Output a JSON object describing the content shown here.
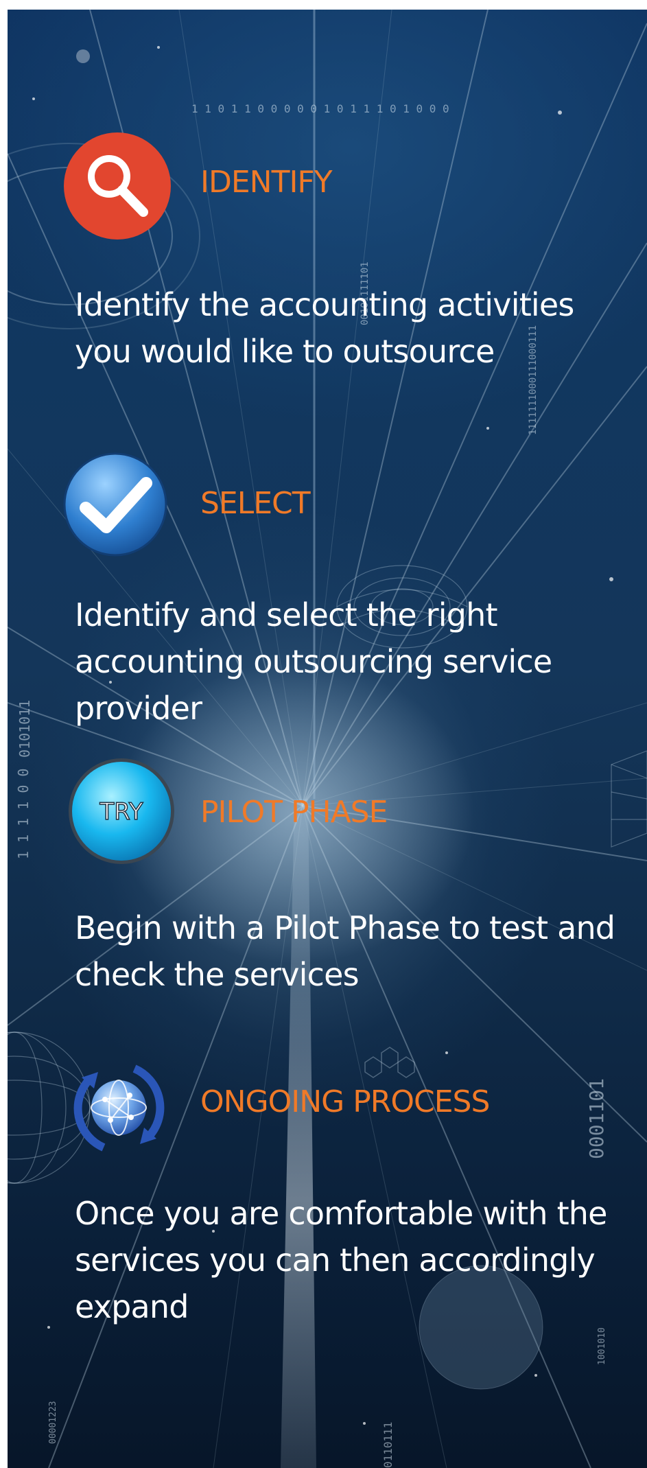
{
  "background": {
    "binary_strings": [
      "1 1 0 1 1 0 0 0 0 0 1 0 1 1 1 0 1 0 0 0",
      "00101111101",
      "1111111000111000111",
      "0101011",
      "0001101",
      "1 1 1 1 0 0",
      "00001223",
      "0110111",
      "1001010"
    ]
  },
  "steps": [
    {
      "icon": "magnifier-icon",
      "icon_color": "#e2462f",
      "title": "IDENTIFY",
      "description": "Identify the accounting activities you would like to outsource"
    },
    {
      "icon": "checkmark-icon",
      "icon_color": "#2f7fd0",
      "title": "SELECT",
      "description": "Identify and select the right accounting outsourcing service provider"
    },
    {
      "icon": "try-icon",
      "icon_label": "TRY",
      "icon_color": "#19b8ef",
      "title": "PILOT PHASE",
      "description": "Begin with a Pilot Phase to test and check the services"
    },
    {
      "icon": "globe-cycle-icon",
      "icon_color": "#2a56b8",
      "title": "ONGOING PROCESS",
      "description": "Once you are comfortable with the services you can then accordingly expand"
    }
  ],
  "colors": {
    "title": "#f07a28",
    "description": "#ffffff",
    "background_top": "#0f3563",
    "background_bottom": "#071629"
  }
}
